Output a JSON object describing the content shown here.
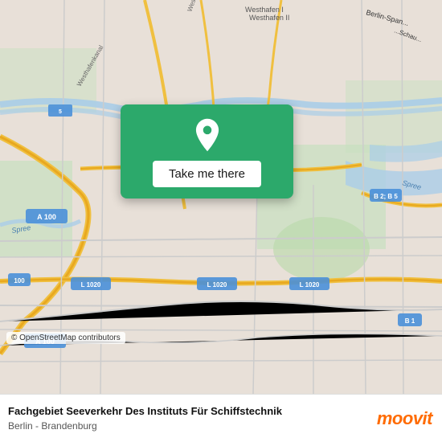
{
  "map": {
    "background_color": "#e8e0d8",
    "center_lat": 52.52,
    "center_lng": 13.38
  },
  "card": {
    "button_label": "Take me there",
    "pin_icon": "location-pin"
  },
  "bottom_bar": {
    "title": "Fachgebiet Seeverkehr Des Instituts Für Schiffstechnik",
    "subtitle": "Berlin - Brandenburg",
    "logo": "moovit",
    "logo_text": "moovit"
  },
  "copyright": {
    "text": "© OpenStreetMap contributors"
  }
}
